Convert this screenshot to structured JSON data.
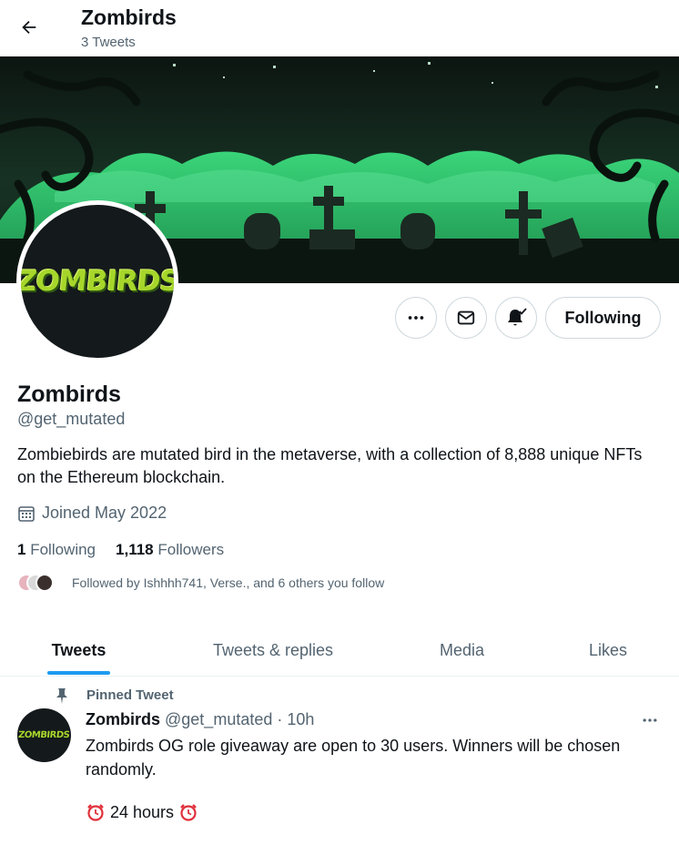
{
  "header": {
    "title": "Zombirds",
    "tweet_count": "3 Tweets",
    "back_icon": "arrow-left-icon"
  },
  "profile": {
    "avatar_logo": "ZOMBIRDS",
    "name": "Zombirds",
    "handle": "@get_mutated",
    "bio": "Zombiebirds are mutated bird in the metaverse, with a collection of 8,888 unique NFTs on the Ethereum blockchain.",
    "joined": "Joined May 2022",
    "following_count": "1",
    "following_label": "Following",
    "followers_count": "1,118",
    "followers_label": "Followers",
    "followed_by": "Followed by Ishhhh741, Verse., and 6 others you follow"
  },
  "actions": {
    "more_icon": "more-icon",
    "message_icon": "envelope-icon",
    "notify_icon": "bell-check-icon",
    "follow_label": "Following"
  },
  "tabs": [
    {
      "label": "Tweets",
      "active": true
    },
    {
      "label": "Tweets & replies",
      "active": false
    },
    {
      "label": "Media",
      "active": false
    },
    {
      "label": "Likes",
      "active": false
    }
  ],
  "pinned_tweet": {
    "pin_label": "Pinned Tweet",
    "author_name": "Zombirds",
    "author_handle": "@get_mutated",
    "separator": "·",
    "time": "10h",
    "text": "Zombirds OG role giveaway are open to 30 users. Winners will be chosen randomly.",
    "extra": "24 hours",
    "avatar_logo": "ZOMBIRDS"
  },
  "colors": {
    "accent": "#1d9bf0",
    "secondary_text": "#536471",
    "banner_green": "#2fc36a",
    "logo_green": "#a7d62b"
  }
}
